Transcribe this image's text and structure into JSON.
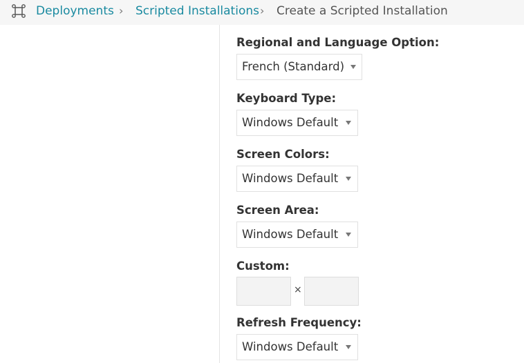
{
  "breadcrumb": {
    "icon": "deployments-icon",
    "items": [
      "Deployments",
      "Scripted Installations",
      "Create a Scripted Installation"
    ],
    "separator": "›"
  },
  "form": {
    "regional": {
      "label": "Regional and Language Option:",
      "value": "French (Standard)"
    },
    "keyboard": {
      "label": "Keyboard Type:",
      "value": "Windows Default"
    },
    "colors": {
      "label": "Screen Colors:",
      "value": "Windows Default"
    },
    "area": {
      "label": "Screen Area:",
      "value": "Windows Default"
    },
    "custom": {
      "label": "Custom:",
      "width": "",
      "height": "",
      "separator": "×"
    },
    "refresh": {
      "label": "Refresh Frequency:",
      "value": "Windows Default"
    }
  },
  "colors": {
    "link": "#1a8aa0",
    "breadcrumb_bg": "#f6f6f6"
  }
}
